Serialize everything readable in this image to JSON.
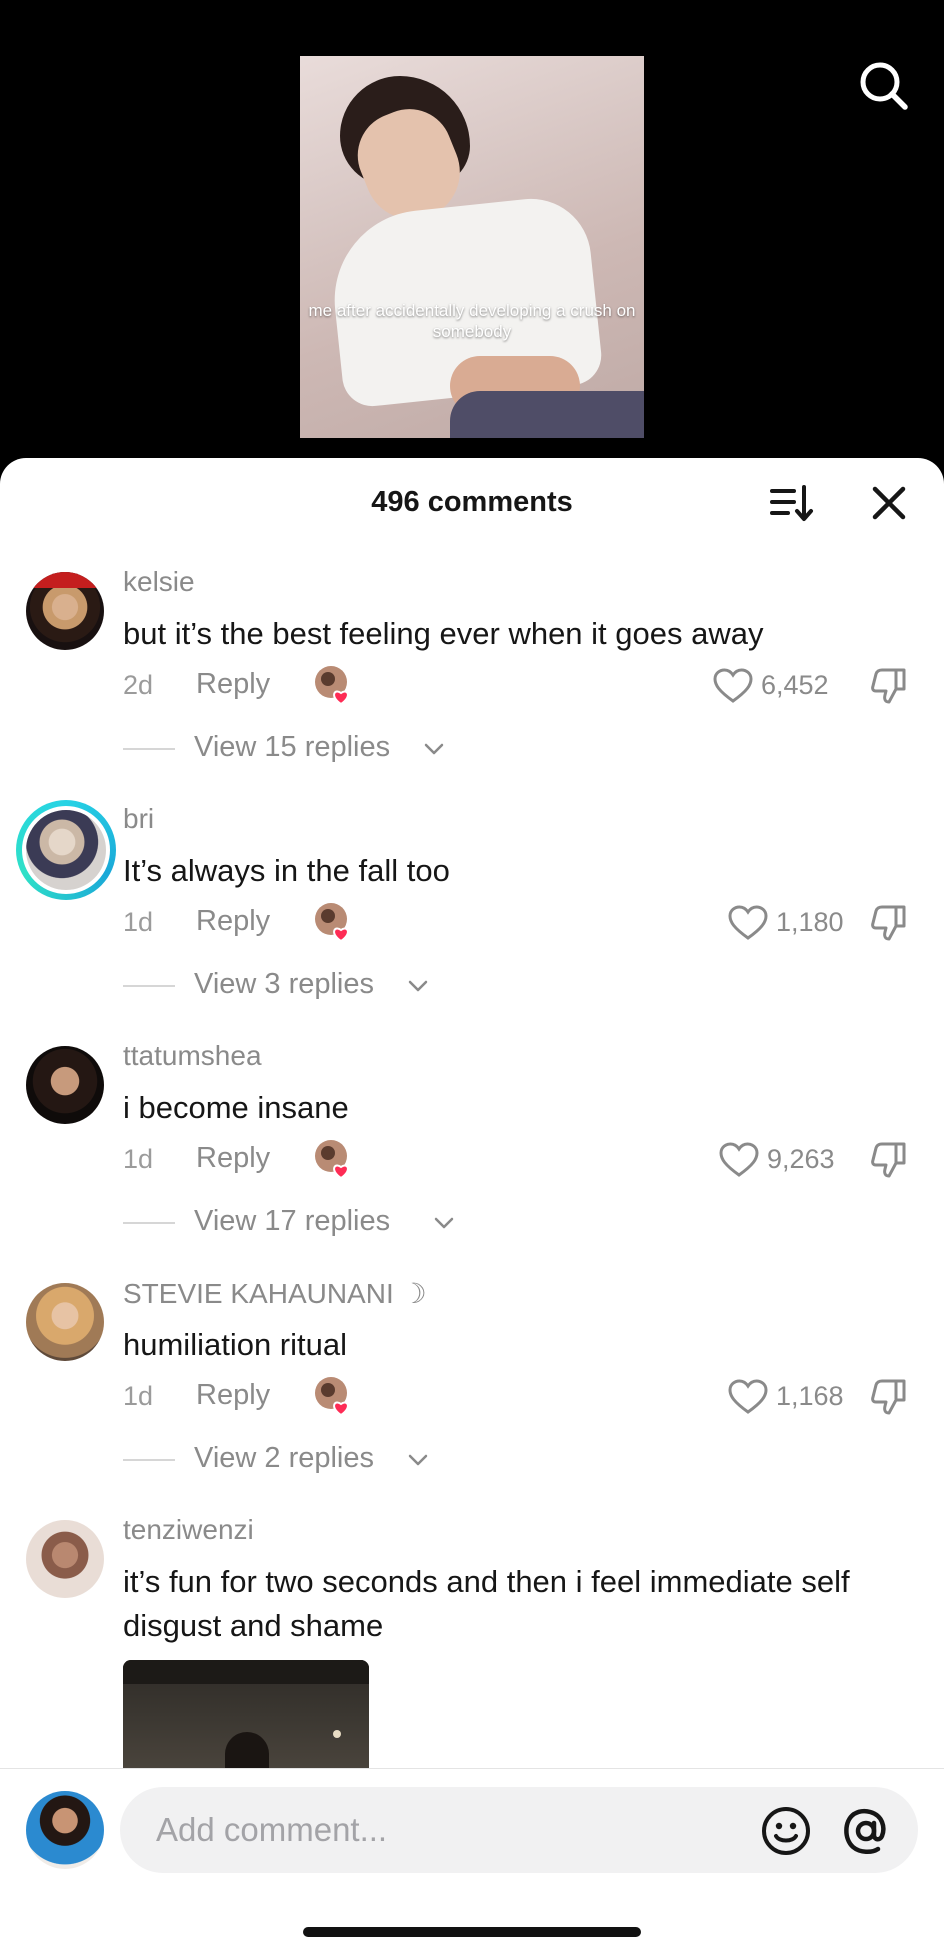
{
  "video": {
    "caption": "me after accidentally developing a crush on somebody"
  },
  "header": {
    "comments_count": "496 comments"
  },
  "icons": {
    "search": "search-icon",
    "sort": "sort-icon",
    "close": "close-icon",
    "heart": "heart-icon",
    "dislike": "thumbs-down-icon",
    "emoji": "smiley-icon",
    "mention": "at-icon"
  },
  "comments": [
    {
      "username": "kelsie",
      "text": "but it’s the best feeling ever when it goes away",
      "age": "2d",
      "reply_label": "Reply",
      "likes": "6,452",
      "view_replies": "View 15 replies"
    },
    {
      "username": "bri",
      "text": "It’s always in the fall too",
      "age": "1d",
      "reply_label": "Reply",
      "likes": "1,180",
      "view_replies": "View 3 replies"
    },
    {
      "username": "ttatumshea",
      "text": "i become insane",
      "age": "1d",
      "reply_label": "Reply",
      "likes": "9,263",
      "view_replies": "View 17 replies"
    },
    {
      "username": "STEVIE KAHAUNANI ☽",
      "text": "humiliation ritual",
      "age": "1d",
      "reply_label": "Reply",
      "likes": "1,168",
      "view_replies": "View 2 replies"
    },
    {
      "username": "tenziwenzi",
      "text": "it’s fun for two seconds and then i feel immediate self disgust and shame"
    }
  ],
  "composer": {
    "placeholder": "Add comment..."
  },
  "colors": {
    "like_heart_creator": "#fe2c55",
    "story_ring": "#27d3e5",
    "secondary_text": "#8a8a8a"
  }
}
